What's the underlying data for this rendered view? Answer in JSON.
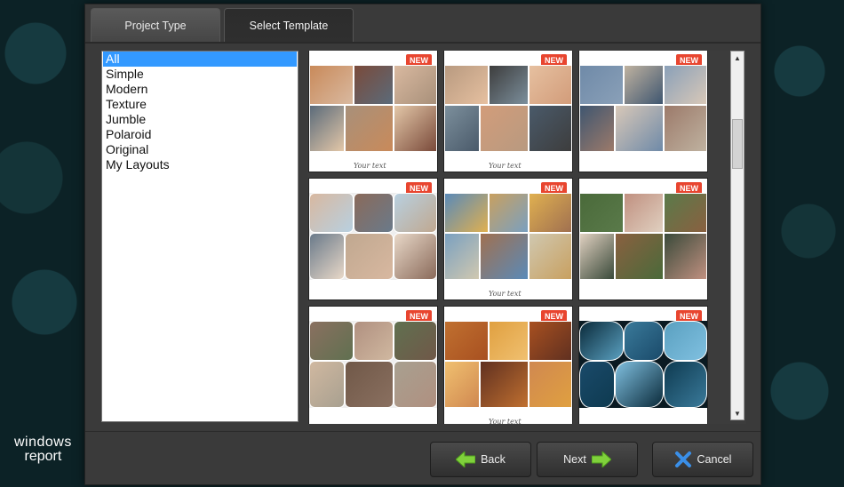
{
  "tabs": [
    {
      "label": "Project Type",
      "active": false
    },
    {
      "label": "Select Template",
      "active": true
    }
  ],
  "categories": [
    "All",
    "Simple",
    "Modern",
    "Texture",
    "Jumble",
    "Polaroid",
    "Original",
    "My Layouts"
  ],
  "selected_category": "All",
  "templates": {
    "badge": "NEW",
    "caption": "Your text",
    "count": 9
  },
  "buttons": {
    "back": "Back",
    "next": "Next",
    "cancel": "Cancel"
  },
  "logo": {
    "line1": "windows",
    "line2": "report"
  },
  "colors": {
    "selection": "#3399ff",
    "badge": "#e8452f",
    "arrow_green": "#7fd13b",
    "cancel_blue": "#3a8fe8"
  }
}
